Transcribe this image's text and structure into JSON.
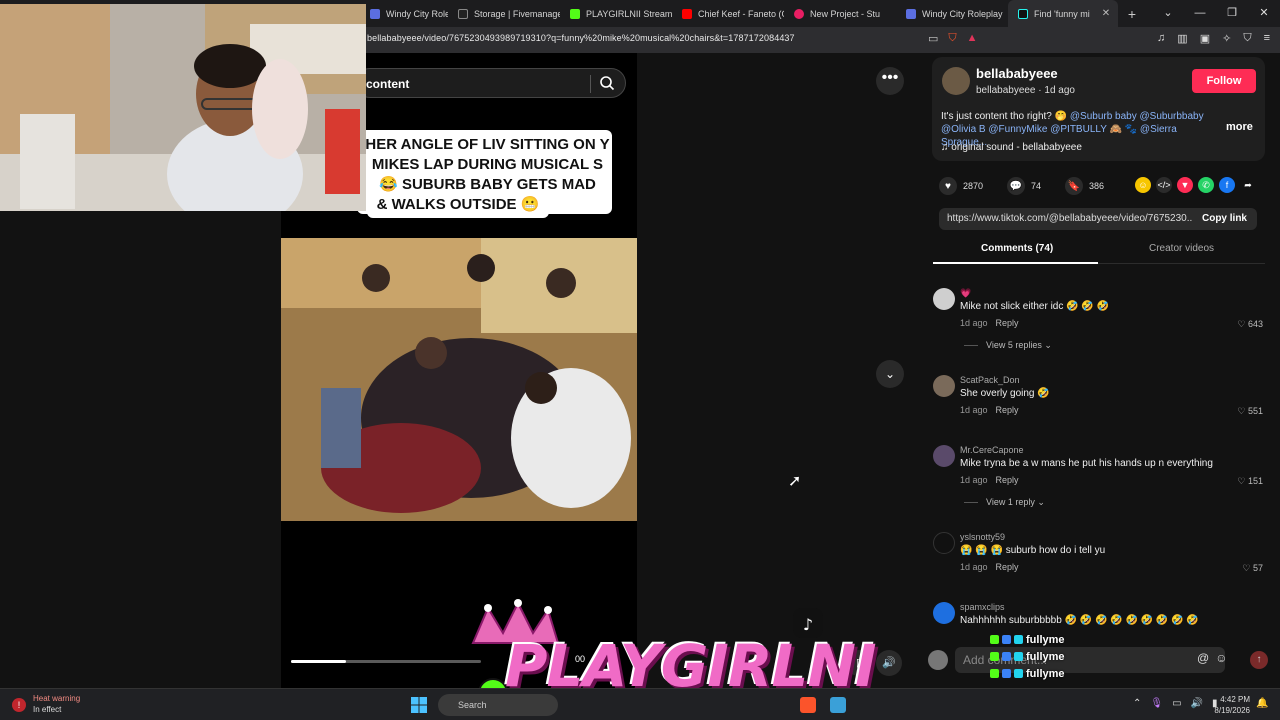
{
  "browser": {
    "tabs": [
      {
        "label": "Windy City Roleplay",
        "color": "#5b6ee1"
      },
      {
        "label": "Storage | Fivemanage",
        "color": "#222222"
      },
      {
        "label": "PLAYGIRLNII Stream",
        "color": "#53fc18"
      },
      {
        "label": "Chief Keef - Faneto (C",
        "color": "#ff0000"
      },
      {
        "label": "New Project - Stu",
        "color": "#e91e63"
      },
      {
        "label": "Windy City Roleplay",
        "color": "#5b6ee1"
      },
      {
        "label": "Find 'funny mi",
        "color": "#111111"
      }
    ],
    "url": "bellababyeee/video/7675230493989719310?q=funny%20mike%20musical%20chairs&t=1787172084437"
  },
  "video": {
    "search_label": "content",
    "caption": "HER ANGLE OF LIV SITTING ON Y MIKES LAP DURING MUSICAL S 😂 SUBURB BABY GETS MAD",
    "caption_last": "& WALKS OUTSIDE 😬",
    "progress": 0.29,
    "time_text": "00"
  },
  "post": {
    "author": "bellababyeee",
    "sub": "bellababyeee · 1d ago",
    "follow_label": "Follow",
    "desc_prefix": "It's just content tho right? 🤭 ",
    "desc_mentions": "@Suburb baby @Suburbbaby @Olivia B @FunnyMike @PITBULLY 🙈 🐾 @Sierra Sprague...",
    "more_label": "more",
    "sound": "♫  original sound - bellababyeee",
    "likes": "2870",
    "comments_count": "74",
    "saves": "386",
    "link": "https://www.tiktok.com/@bellababyeee/video/7675230...",
    "copy_label": "Copy link",
    "tab_comments": "Comments (74)",
    "tab_creator": "Creator videos"
  },
  "comments": [
    {
      "user": "💗",
      "text": "Mike not slick either idc 🤣 🤣 🤣",
      "time": "1d ago",
      "reply": "Reply",
      "likes": "643",
      "view": "View 5 replies ⌄",
      "ava": "#cfcfcf"
    },
    {
      "user": "ScatPack_Don",
      "text": "She overly going 🤣",
      "time": "1d ago",
      "reply": "Reply",
      "likes": "551",
      "view": "",
      "ava": "#7a6a5a"
    },
    {
      "user": "Mr.CereCapone",
      "text": "Mike tryna be a w mans he put his hands up n everything",
      "time": "1d ago",
      "reply": "Reply",
      "likes": "151",
      "view": "View 1 reply ⌄",
      "ava": "#5a4a6a"
    },
    {
      "user": "yslsnotty59",
      "text": "😭 😭 😭  suburb how do i tell yu",
      "time": "1d ago",
      "reply": "Reply",
      "likes": "57",
      "view": "",
      "ava": "#111111"
    },
    {
      "user": "spamxclips",
      "text": "Nahhhhhh suburbbbbb 🤣 🤣 🤣 🤣 🤣 🤣 🤣 🤣 🤣",
      "time": "",
      "reply": "",
      "likes": "",
      "view": "",
      "ava": "#1e6fe0"
    }
  ],
  "add_comment": {
    "placeholder": "Add comment..."
  },
  "overlay": {
    "brand": "PLAYGIRLNI",
    "chat_user": "fullyme"
  },
  "taskbar": {
    "heat_title": "Heat warning",
    "heat_sub": "In effect",
    "search_label": "Search",
    "time": "4:42 PM",
    "date": "8/19/2026"
  }
}
